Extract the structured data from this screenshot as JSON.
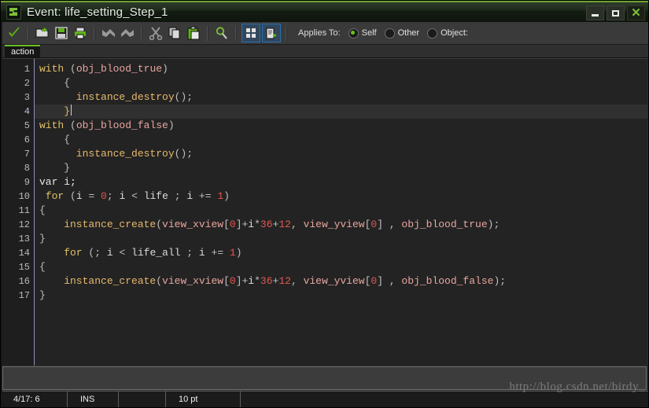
{
  "window": {
    "title": "Event: life_setting_Step_1",
    "icon": "gamemaker-icon",
    "minimize_label": "–",
    "maximize_label": "□",
    "close_label": "✕"
  },
  "toolbar": {
    "buttons": [
      {
        "name": "confirm-check-button",
        "title": "OK"
      },
      {
        "name": "open-folder-button",
        "title": "Open"
      },
      {
        "name": "save-button",
        "title": "Save"
      },
      {
        "name": "print-button",
        "title": "Print"
      },
      {
        "name": "undo-button",
        "title": "Undo"
      },
      {
        "name": "redo-button",
        "title": "Redo"
      },
      {
        "name": "cut-button",
        "title": "Cut"
      },
      {
        "name": "copy-button",
        "title": "Copy"
      },
      {
        "name": "paste-button",
        "title": "Paste"
      },
      {
        "name": "search-button",
        "title": "Find"
      },
      {
        "name": "show-variables-button",
        "title": "Variables"
      },
      {
        "name": "show-functions-button",
        "title": "Functions"
      }
    ],
    "applies_to_label": "Applies To:",
    "applies_to_options": [
      {
        "label": "Self",
        "selected": true
      },
      {
        "label": "Other",
        "selected": false
      },
      {
        "label": "Object:",
        "selected": false
      }
    ],
    "accent_color": "#6cc024",
    "frame_color": "#2a6fb0"
  },
  "tabs": [
    {
      "label": "action",
      "active": true
    }
  ],
  "editor": {
    "line_count": 17,
    "current_line": 4,
    "line_numbers": [
      "1",
      "2",
      "3",
      "4",
      "5",
      "6",
      "7",
      "8",
      "9",
      "10",
      "11",
      "12",
      "13",
      "14",
      "15",
      "16",
      "17"
    ],
    "lines": [
      "with (obj_blood_true)",
      "    {",
      "      instance_destroy();",
      "    }",
      "with (obj_blood_false)",
      "    {",
      "      instance_destroy();",
      "    }",
      "var i;",
      " for (i = 0; i < life ; i += 1)",
      "{",
      "    instance_create(view_xview[0]+i*36+12, view_yview[0] , obj_blood_true);",
      "}",
      "    for (; i < life_all ; i += 1)",
      "{",
      "    instance_create(view_xview[0]+i*36+12, view_yview[0] , obj_blood_false);",
      "}"
    ],
    "colors": {
      "background": "#232323",
      "gutter_background": "#1e1e1e",
      "gutter_border": "#8d8fc0",
      "current_line": "#303030",
      "keyword": "#e3c16a",
      "resource": "#e8a6a0",
      "function": "#e8b96b",
      "number": "#e0574f",
      "text": "#d8d8d8"
    }
  },
  "statusbar": {
    "position": "4/17:  6",
    "insert_mode": "INS",
    "blank": "",
    "font_size": "10 pt",
    "trailing": ""
  },
  "watermark": {
    "text": "http://blog.csdn.net/birdy_"
  }
}
